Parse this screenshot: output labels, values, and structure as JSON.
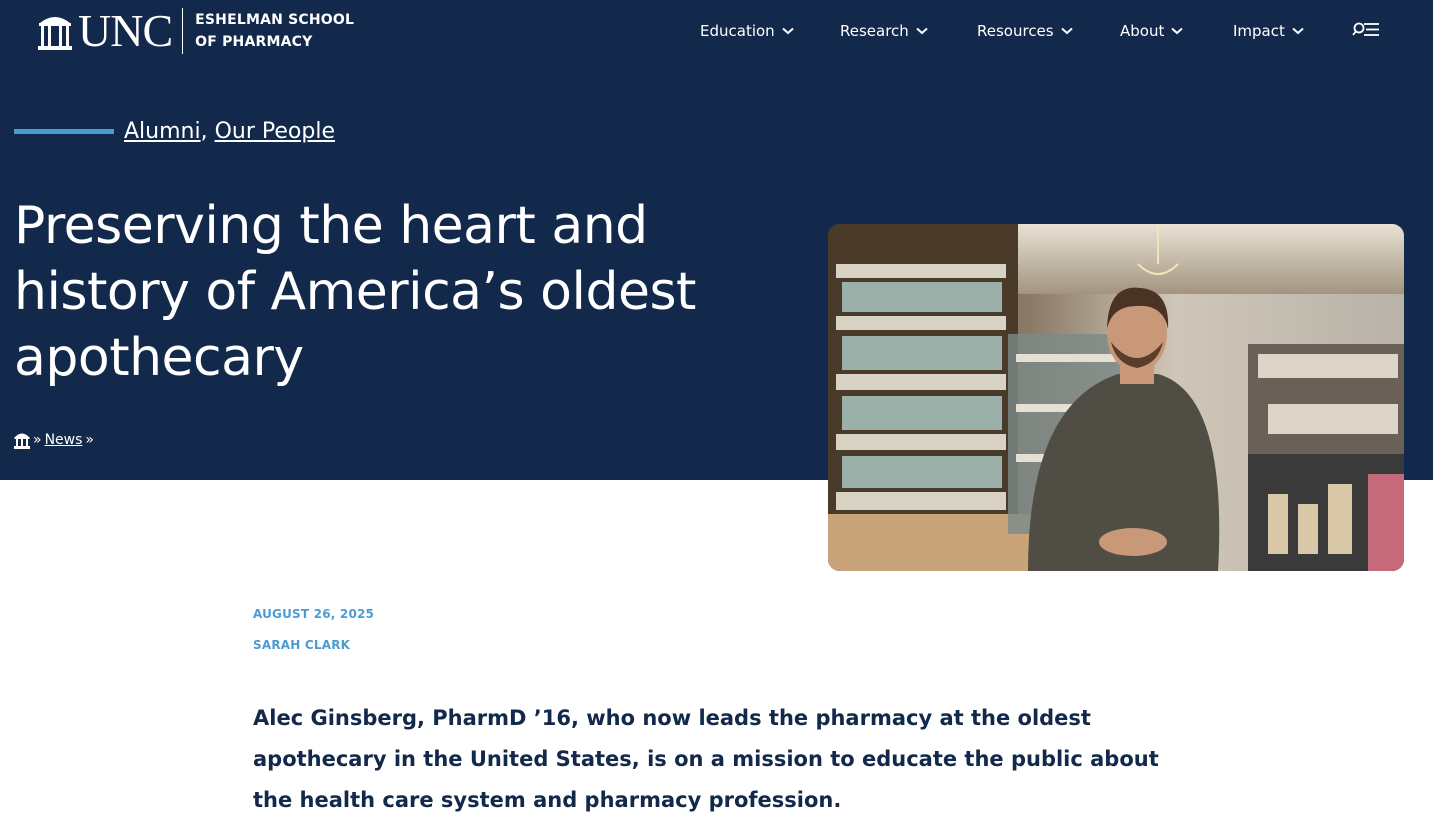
{
  "header": {
    "logo_text": "UNC",
    "school_line1": "ESHELMAN SCHOOL",
    "school_line2": "OF PHARMACY",
    "nav": [
      {
        "label": "Education",
        "icon": "chevron-down-icon"
      },
      {
        "label": "Research",
        "icon": "chevron-down-icon"
      },
      {
        "label": "Resources",
        "icon": "chevron-down-icon"
      },
      {
        "label": "About",
        "icon": "chevron-down-icon"
      },
      {
        "label": "Impact",
        "icon": "chevron-down-icon"
      }
    ],
    "search_menu_icon": "search-menu-icon"
  },
  "article": {
    "categories": [
      "Alumni",
      "Our People"
    ],
    "category_separator": ",",
    "title": "Preserving the heart and history of America’s oldest apothecary",
    "breadcrumb": {
      "home_icon": "home-icon",
      "separator": "»",
      "items": [
        "News"
      ]
    },
    "date": "AUGUST 26, 2025",
    "author": "SARAH CLARK",
    "lede": "Alec Ginsberg, PharmD ’16, who now leads the pharmacy at the oldest apothecary in the United States, is on a mission to educate the public about the health care system and pharmacy profession."
  },
  "colors": {
    "navy": "#13294b",
    "carolina_blue": "#4b9cd3",
    "white": "#ffffff"
  }
}
